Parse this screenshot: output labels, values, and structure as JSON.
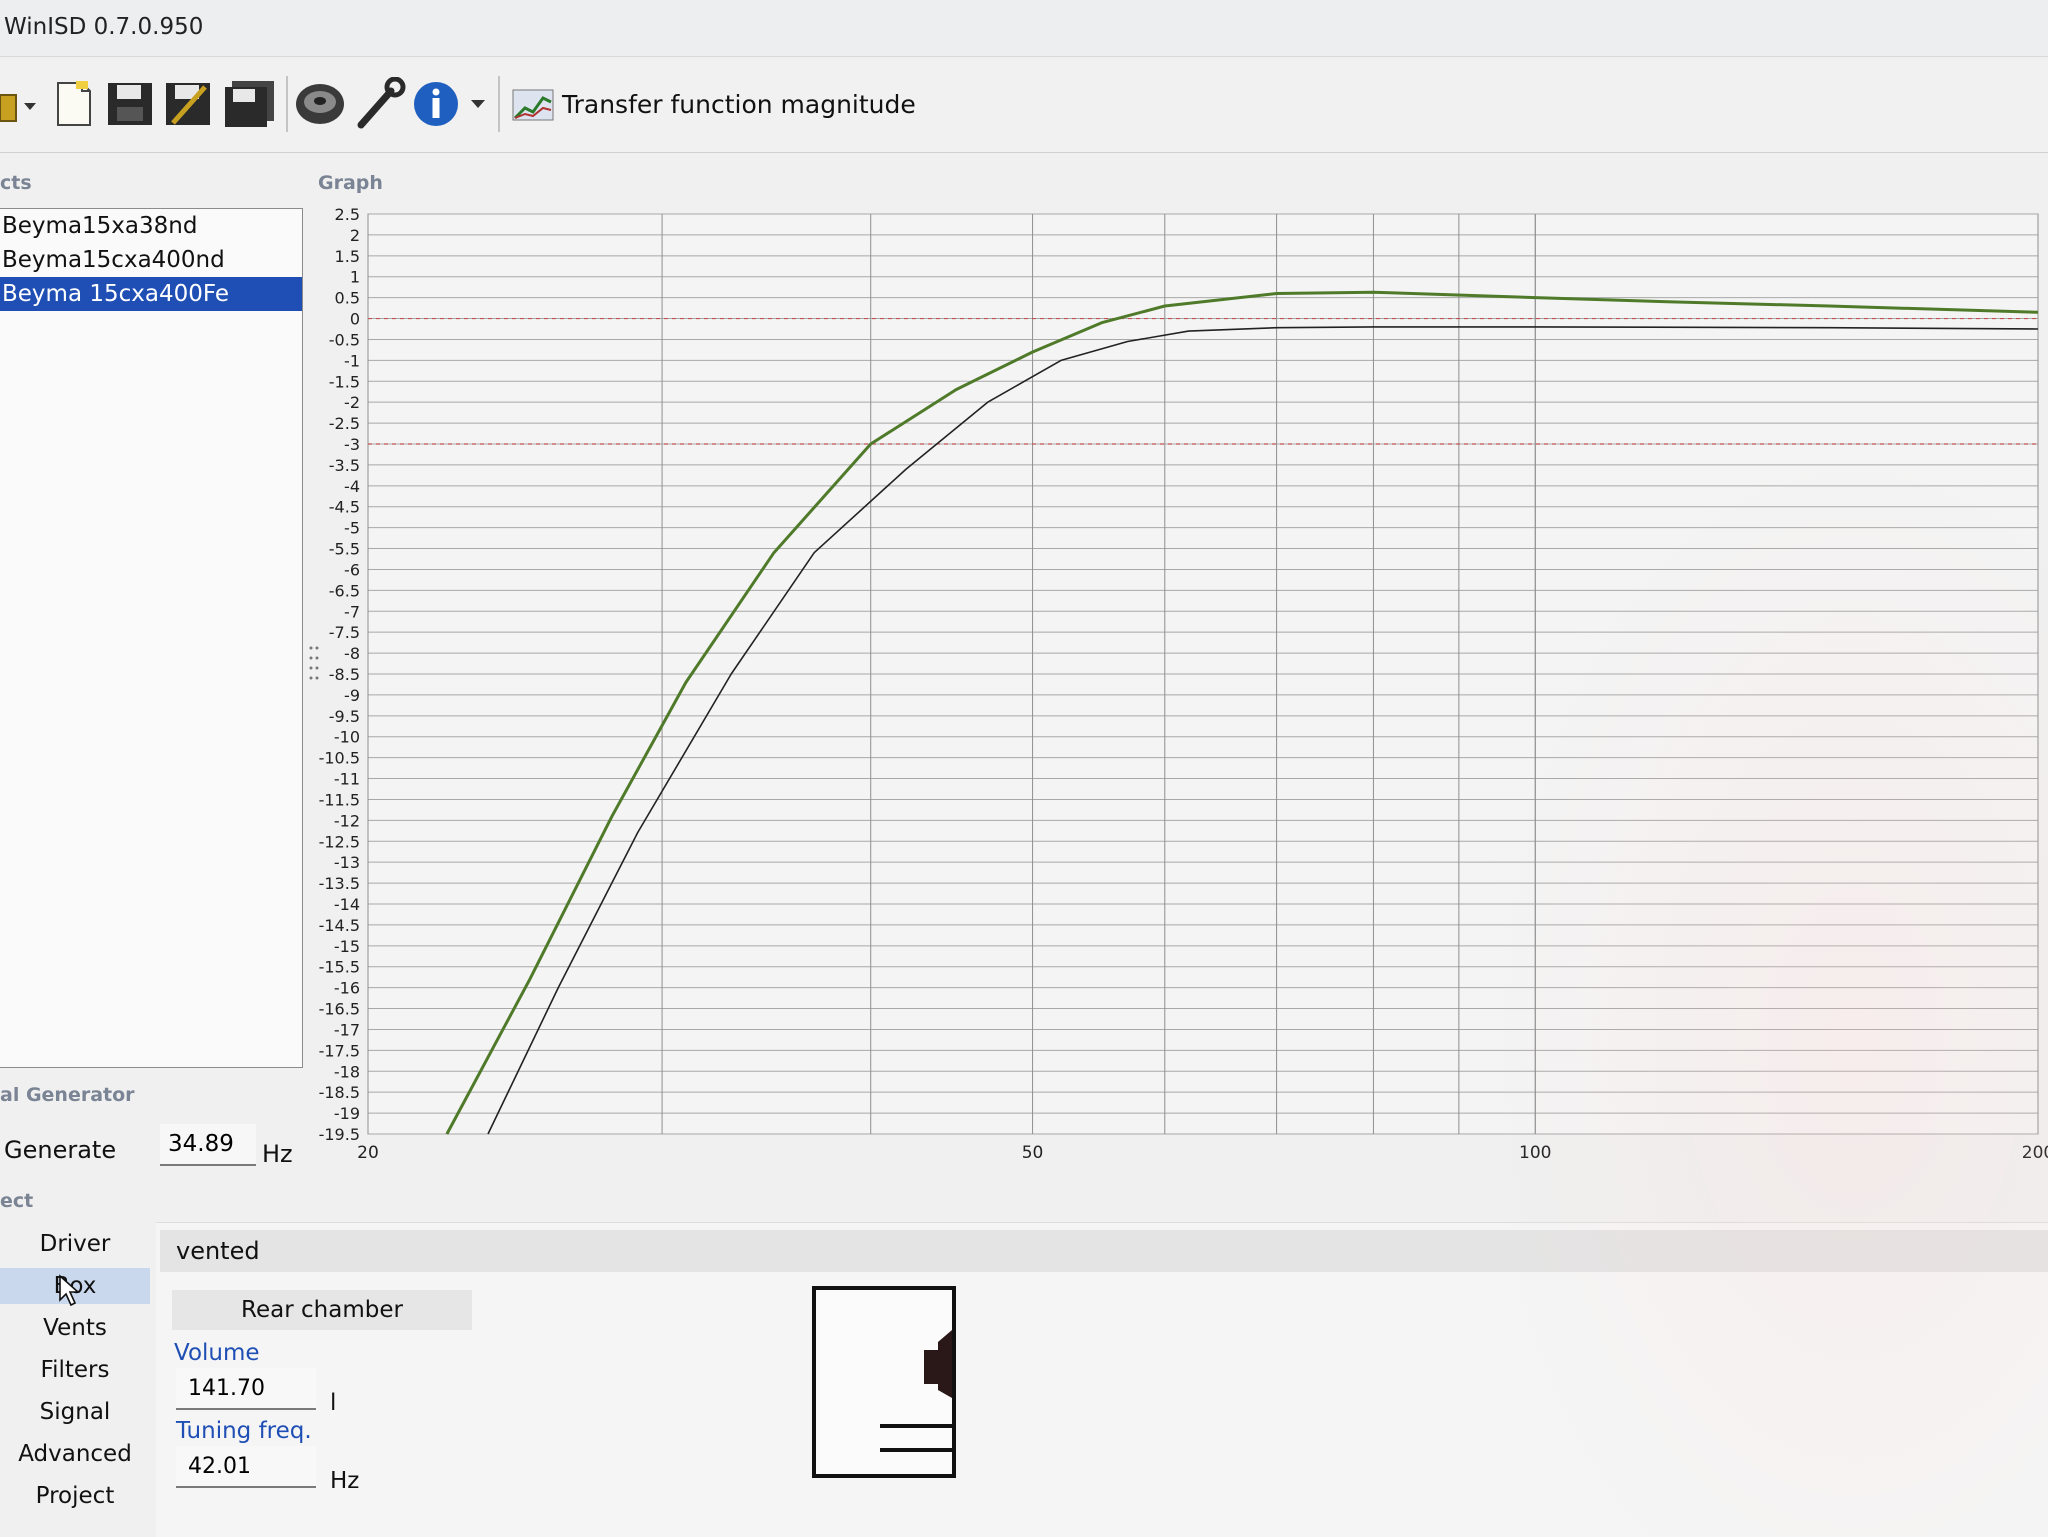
{
  "window": {
    "title": "WinISD 0.7.0.950"
  },
  "toolbar": {
    "tools": [
      {
        "name": "open-icon"
      },
      {
        "name": "new-project-icon"
      },
      {
        "name": "save-icon"
      },
      {
        "name": "save-as-icon"
      },
      {
        "name": "save-all-icon"
      },
      {
        "name": "driver-editor-icon"
      },
      {
        "name": "tools-icon"
      },
      {
        "name": "info-icon"
      }
    ],
    "graph_selector_label": "Transfer function magnitude"
  },
  "projects": {
    "header": "cts",
    "items": [
      {
        "label": "Beyma15xa38nd",
        "selected": false
      },
      {
        "label": "Beyma15cxa400nd",
        "selected": false
      },
      {
        "label": "Beyma 15cxa400Fe",
        "selected": true
      }
    ]
  },
  "signal_generator": {
    "header": "al Generator",
    "generate_label": "Generate",
    "frequency_value": "34.89",
    "unit": "Hz"
  },
  "project_nav": {
    "header": "ect",
    "items": [
      {
        "label": "Driver",
        "active": false
      },
      {
        "label": "Box",
        "active": true
      },
      {
        "label": "Vents",
        "active": false
      },
      {
        "label": "Filters",
        "active": false
      },
      {
        "label": "Signal",
        "active": false
      },
      {
        "label": "Advanced",
        "active": false
      },
      {
        "label": "Project",
        "active": false
      }
    ]
  },
  "box": {
    "type": "vented",
    "tab_label": "Rear chamber",
    "volume_label": "Volume",
    "volume_value": "141.70",
    "volume_unit": "l",
    "tuning_label": "Tuning freq.",
    "tuning_value": "42.01",
    "tuning_unit": "Hz"
  },
  "graph": {
    "header": "Graph"
  },
  "chart_data": {
    "type": "line",
    "xscale": "log",
    "xlim": [
      20,
      200
    ],
    "ylim": [
      -19.5,
      2.5
    ],
    "xticks": [
      20,
      50,
      100,
      200
    ],
    "yticks": [
      2.5,
      2,
      1.5,
      1,
      0.5,
      0,
      -0.5,
      -1,
      -1.5,
      -2,
      -2.5,
      -3,
      -3.5,
      -4,
      -4.5,
      -5,
      -5.5,
      -6,
      -6.5,
      -7,
      -7.5,
      -8,
      -8.5,
      -9,
      -9.5,
      -10,
      -10.5,
      -11,
      -11.5,
      -12,
      -12.5,
      -13,
      -13.5,
      -14,
      -14.5,
      -15,
      -15.5,
      -16,
      -16.5,
      -17,
      -17.5,
      -18,
      -18.5,
      -19,
      -19.5
    ],
    "reference_lines_y": [
      0,
      -3
    ],
    "grid": true,
    "series": [
      {
        "color": "#4f7a2a",
        "x": [
          22.3,
          25,
          28,
          31,
          35,
          40,
          45,
          50,
          55,
          60,
          70,
          80,
          100,
          120,
          150,
          200
        ],
        "y": [
          -19.5,
          -15.8,
          -11.9,
          -8.7,
          -5.6,
          -3.0,
          -1.7,
          -0.8,
          -0.1,
          0.3,
          0.6,
          0.63,
          0.5,
          0.4,
          0.3,
          0.15
        ]
      },
      {
        "color": "#222222",
        "x": [
          23.6,
          26,
          29,
          33,
          37,
          42,
          47,
          52,
          57,
          62,
          70,
          80,
          100,
          150,
          200
        ],
        "y": [
          -19.5,
          -16.0,
          -12.3,
          -8.5,
          -5.6,
          -3.6,
          -2.0,
          -1.0,
          -0.55,
          -0.3,
          -0.22,
          -0.2,
          -0.2,
          -0.22,
          -0.25
        ]
      }
    ]
  }
}
